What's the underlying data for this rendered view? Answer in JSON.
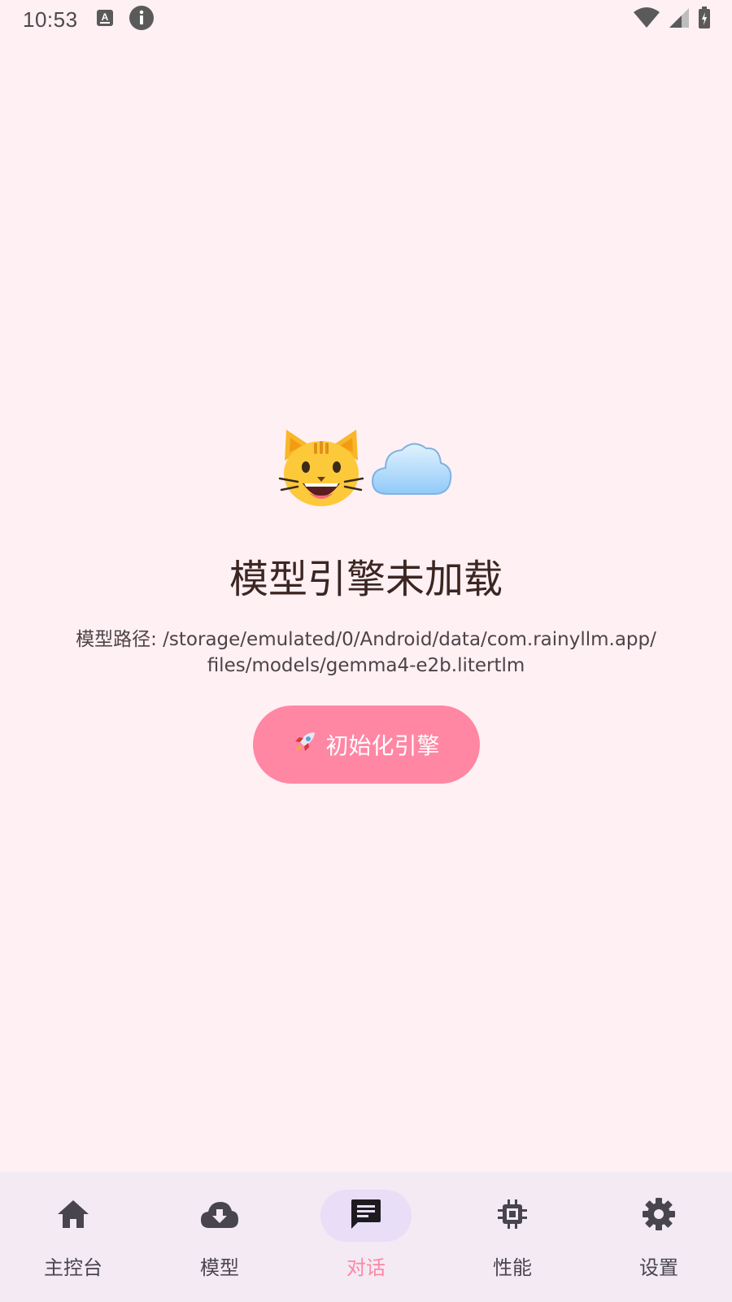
{
  "status_bar": {
    "time": "10:53"
  },
  "main": {
    "emojis": [
      "cat-face-icon",
      "cloud-icon"
    ],
    "title": "模型引擎未加载",
    "path_line1": "模型路径: /storage/emulated/0/Android/data/com.rainyllm.app/",
    "path_line2": "files/models/gemma4-e2b.litertlm",
    "init_button_label": "初始化引擎"
  },
  "bottom_nav": {
    "items": [
      {
        "label": "主控台",
        "icon": "home-icon"
      },
      {
        "label": "模型",
        "icon": "cloud-download-icon"
      },
      {
        "label": "对话",
        "icon": "chat-icon",
        "active": true
      },
      {
        "label": "性能",
        "icon": "chip-icon"
      },
      {
        "label": "设置",
        "icon": "gear-icon"
      }
    ]
  },
  "colors": {
    "background": "#FFF0F4",
    "accent": "#FF87A3",
    "nav_background": "#F3EAF4",
    "active_pill": "#E8DEF8"
  }
}
